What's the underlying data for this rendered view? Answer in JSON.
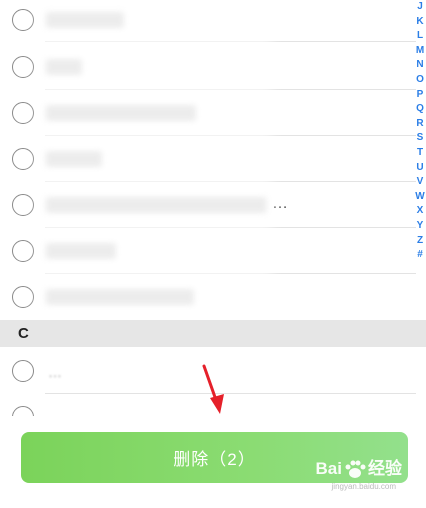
{
  "section_header": {
    "letter": "C"
  },
  "contact_rows": [
    {
      "name_width": 78
    },
    {
      "name_width": 36
    },
    {
      "name_width": 150
    },
    {
      "name_width": 56
    },
    {
      "name_width": 220,
      "truncated": true
    },
    {
      "name_width": 70
    },
    {
      "name_width": 148
    }
  ],
  "partial_row_text": "…",
  "index_letters": [
    "J",
    "K",
    "L",
    "M",
    "N",
    "O",
    "P",
    "Q",
    "R",
    "S",
    "T",
    "U",
    "V",
    "W",
    "X",
    "Y",
    "Z",
    "#"
  ],
  "index_bar": {
    "color": "#2b7ee6"
  },
  "ellipsis_text": "…",
  "delete_button": {
    "label": "删除（2）"
  },
  "watermark": {
    "text": "Bai",
    "suffix": "经验",
    "sub": "jingyan.baidu.com"
  }
}
